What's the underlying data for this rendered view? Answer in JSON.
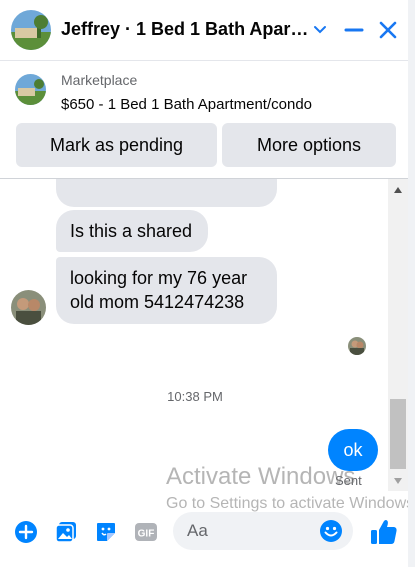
{
  "header": {
    "title": "Jeffrey · 1 Bed 1 Bath Apart...",
    "avatar_icon": "listing-photo-icon",
    "chevron_icon": "chevron-down-icon",
    "minimize_icon": "minimize-icon",
    "close_icon": "close-icon"
  },
  "listing": {
    "source": "Marketplace",
    "item": "$650 - 1 Bed 1 Bath Apartment/condo",
    "mark_pending_label": "Mark as pending",
    "more_options_label": "More options"
  },
  "messages": {
    "incoming": [
      {
        "text": "Is this a shared"
      },
      {
        "text": "looking for my 76 year old mom 5412474238"
      }
    ],
    "timestamp": "10:38 PM",
    "outgoing": {
      "text": "ok",
      "status": "Sent"
    }
  },
  "watermark": {
    "line1": "Activate Windows",
    "line2": "Go to Settings to activate Windows."
  },
  "composer": {
    "placeholder": "Aa",
    "icons": [
      "plus-icon",
      "photo-icon",
      "sticker-icon",
      "gif-icon",
      "emoji-icon",
      "like-icon"
    ]
  },
  "colors": {
    "accent": "#0084ff",
    "incoming_bubble": "#e4e6eb",
    "button_bg": "#e4e6eb",
    "secondary_text": "#65676b"
  }
}
